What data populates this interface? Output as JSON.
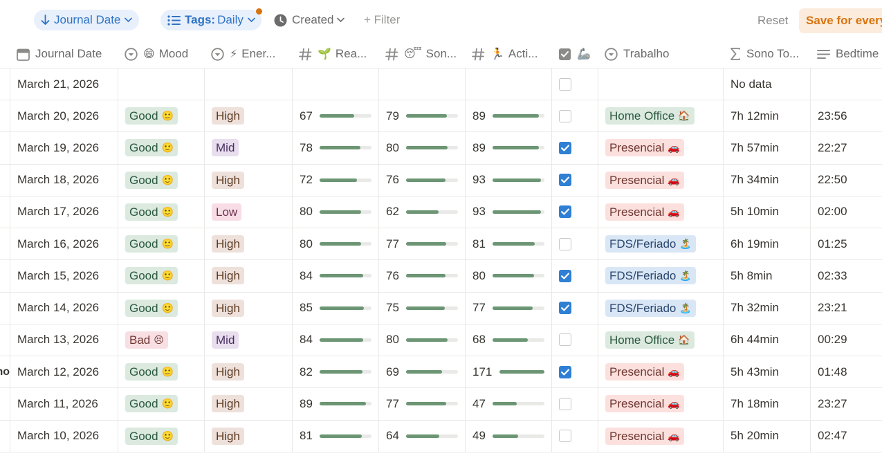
{
  "filters": {
    "sort_label": "Journal Date",
    "tags_prefix": "Tags:",
    "tags_value": "Daily",
    "created_label": "Created",
    "filter_label": "+ Filter",
    "reset_label": "Reset",
    "save_label": "Save for everyone"
  },
  "columns": [
    {
      "label": "Journal Date",
      "icon": "calendar-icon"
    },
    {
      "label": "Mood",
      "icon": "select-icon",
      "emoji": "😄"
    },
    {
      "label": "Ener...",
      "icon": "select-icon",
      "emoji": "⚡"
    },
    {
      "label": "Rea...",
      "icon": "number-icon",
      "emoji": "🌱"
    },
    {
      "label": "Son...",
      "icon": "number-icon",
      "emoji": "😴"
    },
    {
      "label": "Acti...",
      "icon": "number-icon",
      "emoji": "🏃"
    },
    {
      "label": "",
      "icon": "checkbox-icon",
      "emoji": "🦾"
    },
    {
      "label": "Trabalho",
      "icon": "select-icon"
    },
    {
      "label": "Sono To...",
      "icon": "sigma-icon"
    },
    {
      "label": "Bedtime",
      "icon": "text-icon"
    }
  ],
  "stub_label": "no",
  "rows": [
    {
      "date": "March 21, 2026",
      "mood": "",
      "energy": "",
      "rea": null,
      "son": null,
      "act": null,
      "done": false,
      "trabalho": "",
      "sono": "No data",
      "bed": ""
    },
    {
      "date": "March 20, 2026",
      "mood": "Good",
      "energy": "High",
      "rea": 67,
      "son": 79,
      "act": 89,
      "done": false,
      "trabalho": "Home Office",
      "sono": "7h 12min",
      "bed": "23:56"
    },
    {
      "date": "March 19, 2026",
      "mood": "Good",
      "energy": "Mid",
      "rea": 78,
      "son": 80,
      "act": 89,
      "done": true,
      "trabalho": "Presencial",
      "sono": "7h 57min",
      "bed": "22:27"
    },
    {
      "date": "March 18, 2026",
      "mood": "Good",
      "energy": "High",
      "rea": 72,
      "son": 76,
      "act": 93,
      "done": true,
      "trabalho": "Presencial",
      "sono": "7h 34min",
      "bed": "22:50"
    },
    {
      "date": "March 17, 2026",
      "mood": "Good",
      "energy": "Low",
      "rea": 80,
      "son": 62,
      "act": 93,
      "done": true,
      "trabalho": "Presencial",
      "sono": "5h 10min",
      "bed": "02:00"
    },
    {
      "date": "March 16, 2026",
      "mood": "Good",
      "energy": "High",
      "rea": 80,
      "son": 77,
      "act": 81,
      "done": false,
      "trabalho": "FDS/Feriado",
      "sono": "6h 19min",
      "bed": "01:25"
    },
    {
      "date": "March 15, 2026",
      "mood": "Good",
      "energy": "High",
      "rea": 84,
      "son": 76,
      "act": 80,
      "done": true,
      "trabalho": "FDS/Feriado",
      "sono": "5h 8min",
      "bed": "02:33"
    },
    {
      "date": "March 14, 2026",
      "mood": "Good",
      "energy": "High",
      "rea": 85,
      "son": 75,
      "act": 77,
      "done": true,
      "trabalho": "FDS/Feriado",
      "sono": "7h 32min",
      "bed": "23:21"
    },
    {
      "date": "March 13, 2026",
      "mood": "Bad",
      "energy": "Mid",
      "rea": 84,
      "son": 80,
      "act": 68,
      "done": false,
      "trabalho": "Home Office",
      "sono": "6h 44min",
      "bed": "00:29"
    },
    {
      "date": "March 12, 2026",
      "mood": "Good",
      "energy": "High",
      "rea": 82,
      "son": 69,
      "act": 171,
      "done": true,
      "trabalho": "Presencial",
      "sono": "5h 43min",
      "bed": "01:48"
    },
    {
      "date": "March 11, 2026",
      "mood": "Good",
      "energy": "High",
      "rea": 89,
      "son": 77,
      "act": 47,
      "done": false,
      "trabalho": "Presencial",
      "sono": "7h 18min",
      "bed": "23:27"
    },
    {
      "date": "March 10, 2026",
      "mood": "Good",
      "energy": "High",
      "rea": 81,
      "son": 64,
      "act": 49,
      "done": false,
      "trabalho": "Presencial",
      "sono": "5h 20min",
      "bed": "02:47"
    }
  ],
  "tag_emoji": {
    "Good": "🙂",
    "Bad": "😣",
    "Home Office": "🏠",
    "Presencial": "🚗",
    "FDS/Feriado": "🏝️"
  },
  "colors": {
    "accent": "#2f7fd4",
    "bar": "#6c9574",
    "save": "#d9730d"
  }
}
